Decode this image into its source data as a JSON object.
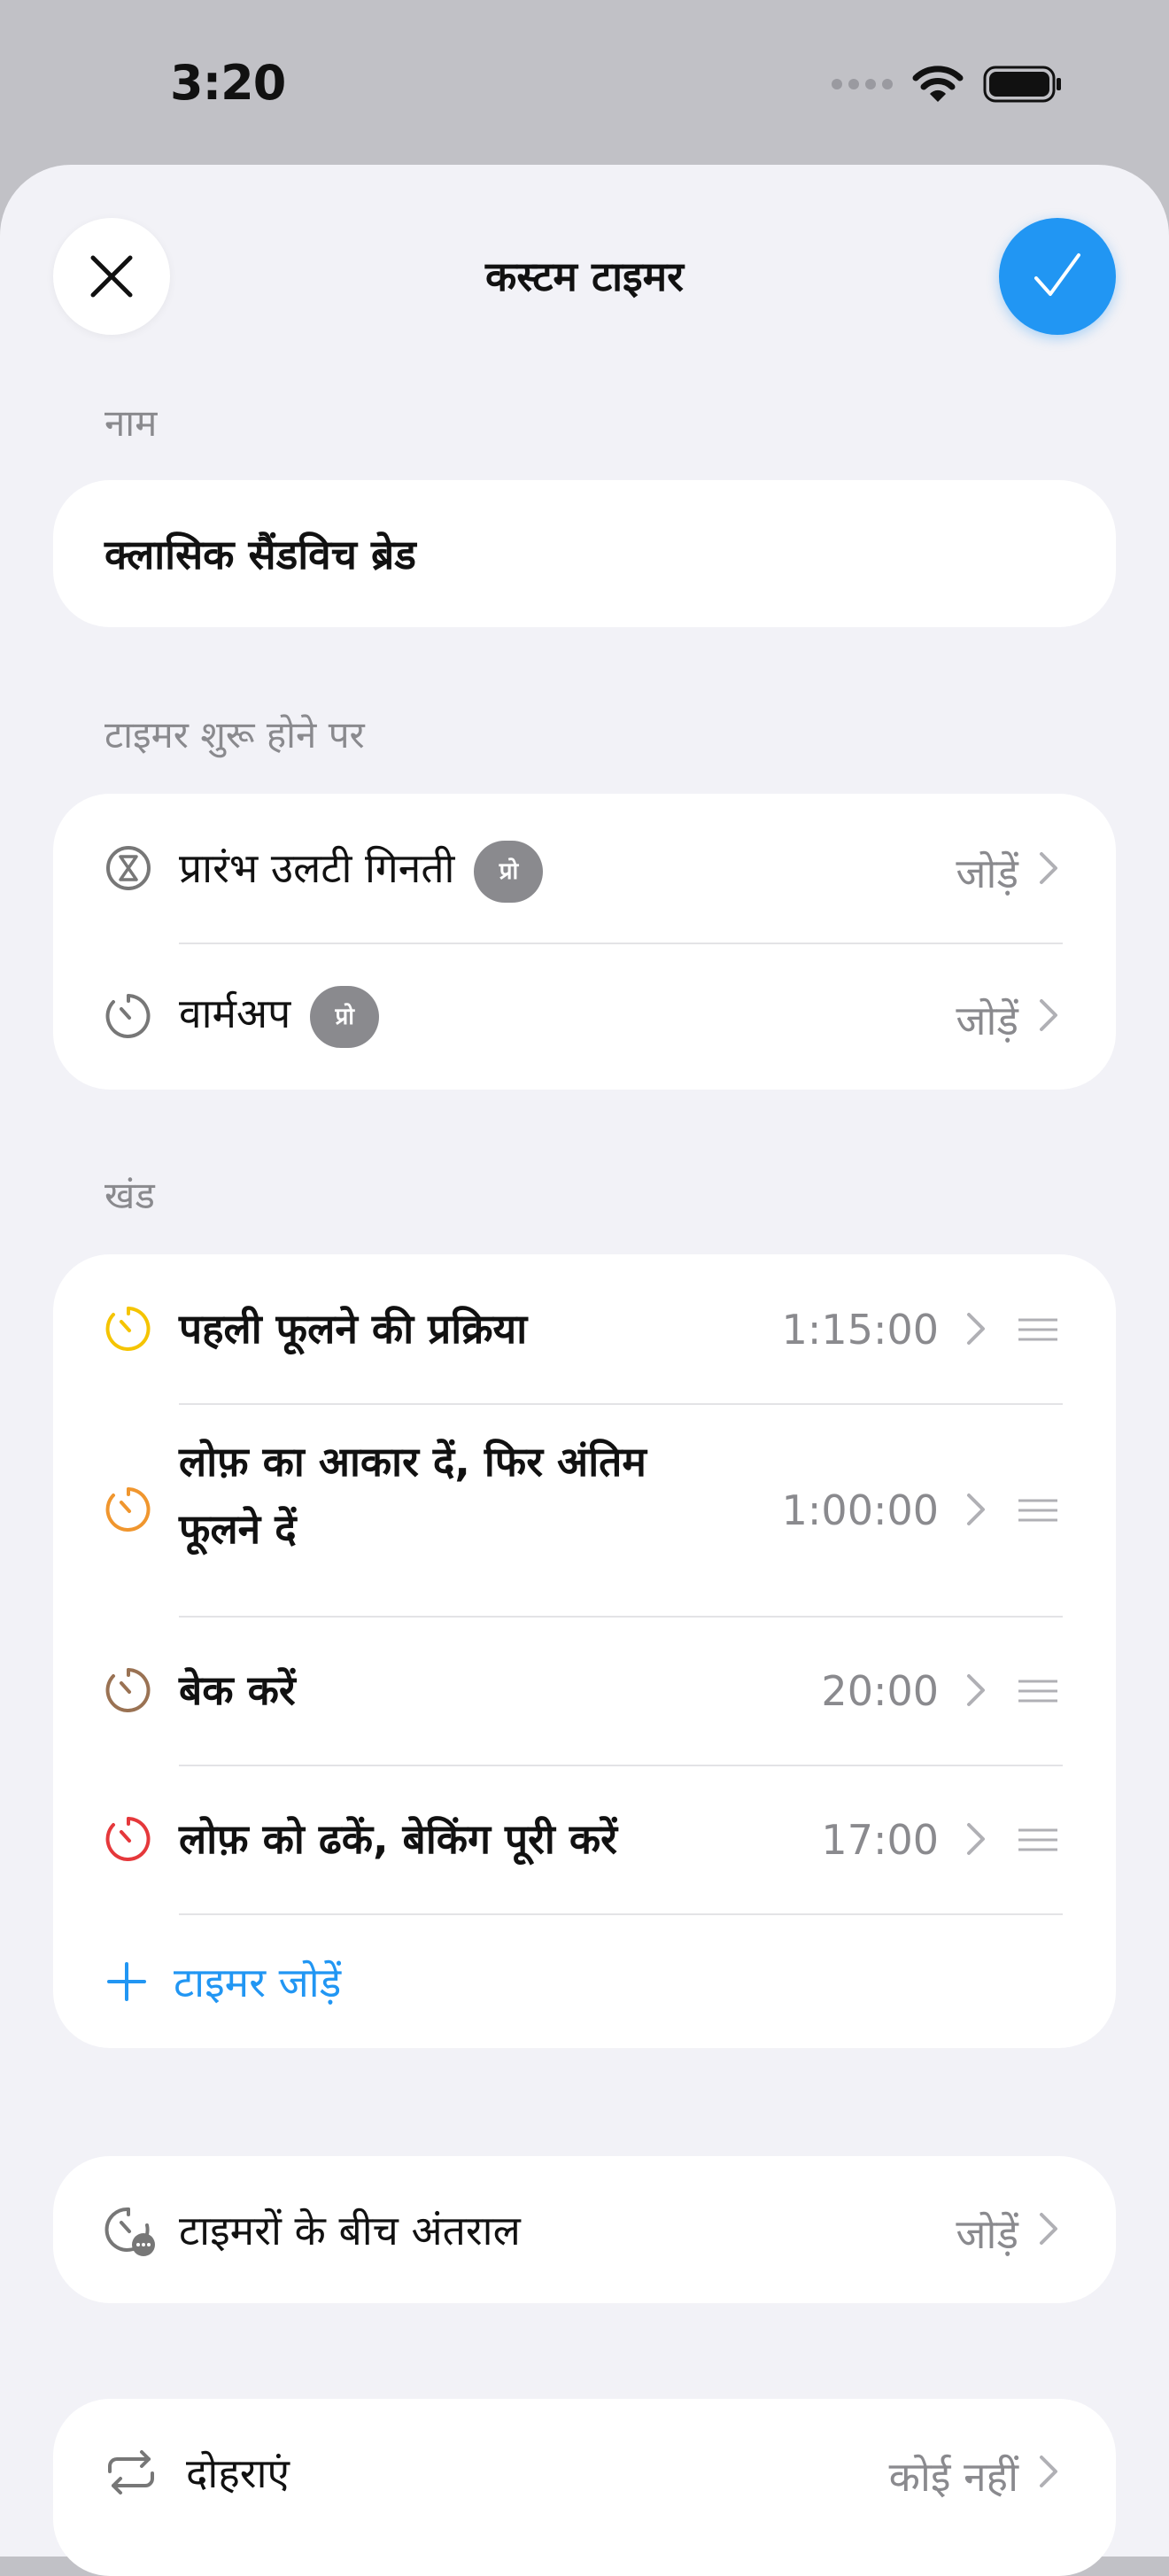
{
  "status_bar": {
    "time": "3:20"
  },
  "header": {
    "title": "कस्टम टाइमर"
  },
  "name_section": {
    "label": "नाम",
    "value": "क्लासिक सैंडविच ब्रेड"
  },
  "start_section": {
    "label": "टाइमर शुरू होने पर",
    "rows": [
      {
        "label": "प्रारंभ उलटी गिनती",
        "badge": "प्रो",
        "action": "जोड़ें",
        "icon": "hourglass-icon"
      },
      {
        "label": "वार्मअप",
        "badge": "प्रो",
        "action": "जोड़ें",
        "icon": "timer-icon"
      }
    ]
  },
  "segments_section": {
    "label": "खंड",
    "items": [
      {
        "line1": "पहली फूलने की प्रक्रिया",
        "line2": "",
        "duration": "1:15:00",
        "color": "#f5c400"
      },
      {
        "line1": "लोफ़ का आकार दें, फिर अंतिम",
        "line2": "फूलने दें",
        "duration": "1:00:00",
        "color": "#f0962e"
      },
      {
        "line1": "बेक करें",
        "line2": "",
        "duration": "20:00",
        "color": "#9a7253"
      },
      {
        "line1": "लोफ़ को ढकें, बेकिंग पूरी करें",
        "line2": "",
        "duration": "17:00",
        "color": "#e5383b"
      }
    ],
    "add_label": "टाइमर जोड़ें"
  },
  "interval_row": {
    "label": "टाइमरों के बीच अंतराल",
    "action": "जोड़ें"
  },
  "repeat_row": {
    "label": "दोहराएं",
    "value": "कोई नहीं"
  },
  "colors": {
    "accent": "#2196f3",
    "secondary_text": "#8a8a8e",
    "sheet_bg": "#f2f2f7",
    "card_bg": "#ffffff"
  }
}
